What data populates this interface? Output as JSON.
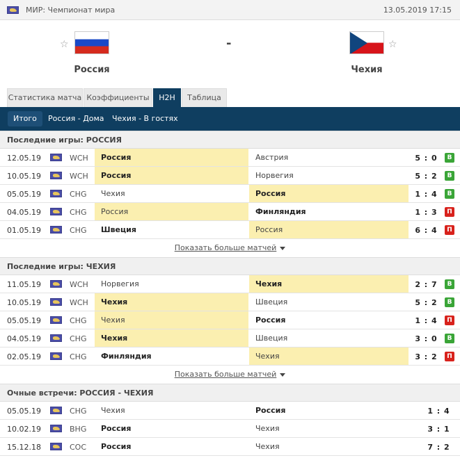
{
  "topbar": {
    "competition": "МИР: Чемпионат мира",
    "datetime": "13.05.2019 17:15"
  },
  "match": {
    "home_team": "Россия",
    "away_team": "Чехия",
    "separator": "-"
  },
  "tabs": [
    "Статистика матча",
    "Коэффициенты",
    "H2H",
    "Таблица"
  ],
  "subtabs": [
    "Итого",
    "Россия - Дома",
    "Чехия - В гостях"
  ],
  "sections": [
    {
      "title": "Последние игры: РОССИЯ",
      "rows": [
        {
          "date": "12.05.19",
          "comp": "WCH",
          "home": "Россия",
          "away": "Австрия",
          "score": "5 : 0",
          "result": "В"
        },
        {
          "date": "10.05.19",
          "comp": "WCH",
          "home": "Россия",
          "away": "Норвегия",
          "score": "5 : 2",
          "result": "В"
        },
        {
          "date": "05.05.19",
          "comp": "CHG",
          "home": "Чехия",
          "away": "Россия",
          "score": "1 : 4",
          "result": "В"
        },
        {
          "date": "04.05.19",
          "comp": "CHG",
          "home": "Россия",
          "away": "Финляндия",
          "score": "1 : 3",
          "result": "П"
        },
        {
          "date": "01.05.19",
          "comp": "CHG",
          "home": "Швеция",
          "away": "Россия",
          "score": "6 : 4",
          "result": "П"
        }
      ],
      "more_label": "Показать больше матчей"
    },
    {
      "title": "Последние игры: ЧЕХИЯ",
      "rows": [
        {
          "date": "11.05.19",
          "comp": "WCH",
          "home": "Норвегия",
          "away": "Чехия",
          "score": "2 : 7",
          "result": "В"
        },
        {
          "date": "10.05.19",
          "comp": "WCH",
          "home": "Чехия",
          "away": "Швеция",
          "score": "5 : 2",
          "result": "В"
        },
        {
          "date": "05.05.19",
          "comp": "CHG",
          "home": "Чехия",
          "away": "Россия",
          "score": "1 : 4",
          "result": "П"
        },
        {
          "date": "04.05.19",
          "comp": "CHG",
          "home": "Чехия",
          "away": "Швеция",
          "score": "3 : 0",
          "result": "В"
        },
        {
          "date": "02.05.19",
          "comp": "CHG",
          "home": "Финляндия",
          "away": "Чехия",
          "score": "3 : 2",
          "result": "П"
        }
      ],
      "more_label": "Показать больше матчей"
    },
    {
      "title": "Очные встречи: РОССИЯ - ЧЕХИЯ",
      "rows": [
        {
          "date": "05.05.19",
          "comp": "CHG",
          "home": "Чехия",
          "away": "Россия",
          "score": "1 : 4"
        },
        {
          "date": "10.02.19",
          "comp": "BHG",
          "home": "Россия",
          "away": "Чехия",
          "score": "3 : 1"
        },
        {
          "date": "15.12.18",
          "comp": "COC",
          "home": "Россия",
          "away": "Чехия",
          "score": "7 : 2"
        }
      ]
    }
  ],
  "colors": {
    "nav": "#0f3e60",
    "highlight": "#fbefb0",
    "win": "#3aa537",
    "loss": "#d8221c"
  },
  "icons": {
    "favorite": "star-outline-icon",
    "competition": "world-flag-icon",
    "expand": "caret-down-icon"
  }
}
